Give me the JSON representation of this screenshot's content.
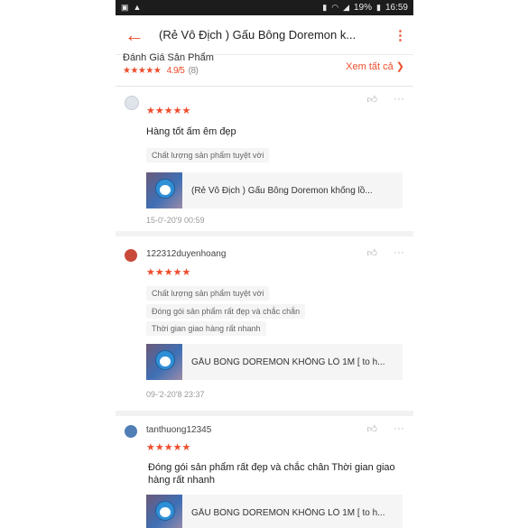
{
  "statusbar": {
    "left_icons": [
      "image-icon",
      "warning-icon"
    ],
    "battery": "19%",
    "time": "16:59"
  },
  "appbar": {
    "back_icon": "arrow-left-icon",
    "title": "(Rẻ Vô  Địch ) Gấu Bông Doremon k...",
    "more_icon": "more-vertical-icon"
  },
  "summary": {
    "title": "Đánh Giá Sản Phẩm",
    "stars": "★★★★★",
    "score": "4.9/5",
    "count": "(8)",
    "see_all": "Xem tất cả ❯"
  },
  "reviews": [
    {
      "username": "",
      "stars": "★★★★★",
      "text": "Hàng tốt ấm êm đẹp",
      "tags": [
        "Chất lượng sản phẩm tuyệt vời"
      ],
      "product": "(Rẻ Vô  Địch ) Gấu Bông Doremon khổng lồ...",
      "date": "15-0'-20'9 00:59"
    },
    {
      "username": "122312duyenhoang",
      "stars": "★★★★★",
      "text": "",
      "tags": [
        "Chất lượng sản phẩm tuyệt vời",
        "Đóng gói sản phẩm rất đẹp và chắc chắn",
        "Thời gian giao hàng rất nhanh"
      ],
      "product": "GẤU BÔNG DOREMON KHỔNG LỒ 1M [ to h...",
      "date": "09-'2-20'8 23:37"
    },
    {
      "username": "tanthuong12345",
      "stars": "★★★★★",
      "text": "Đóng gói sản phẩm rất đẹp và chắc chân Thời gian giao hàng rất nhanh",
      "tags": [],
      "product": "GẤU BÔNG DOREMON KHỔNG LỒ 1M [ to h...",
      "date": ""
    }
  ],
  "icons": {
    "like": "thumbs-up-icon",
    "more": "more-horizontal-icon"
  },
  "colors": {
    "accent": "#ee4d2d"
  }
}
